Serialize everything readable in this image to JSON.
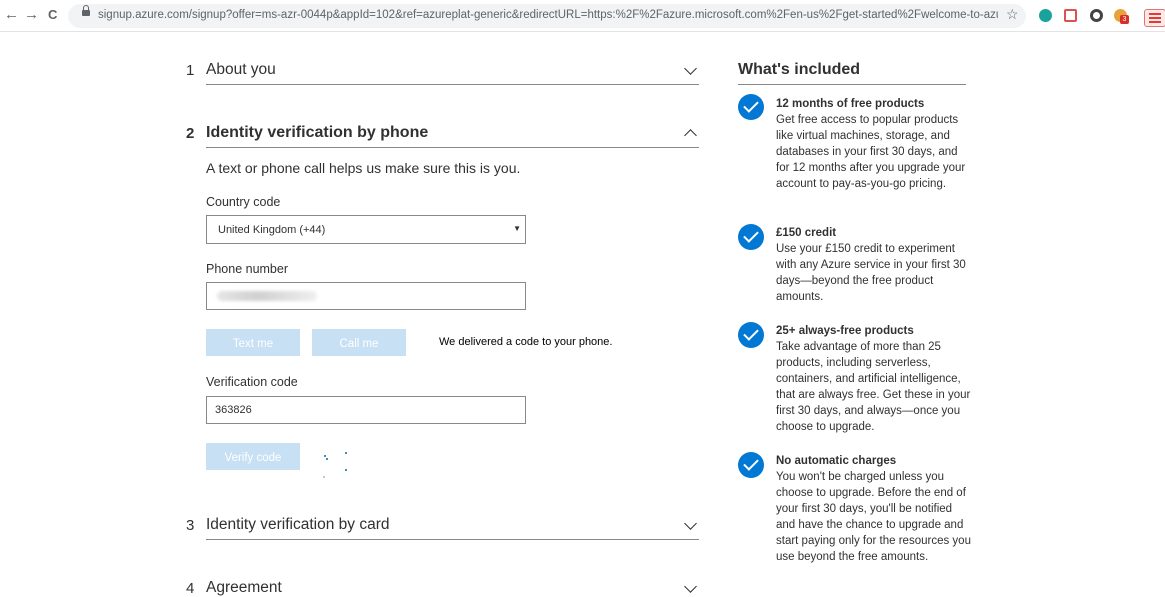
{
  "browser": {
    "back": "←",
    "forward": "→",
    "reload": "C",
    "url": "signup.azure.com/signup?offer=ms-azr-0044p&appId=102&ref=azureplat-generic&redirectURL=https:%2F%2Fazure.microsoft.com%2Fen-us%2Fget-started%2Fwelcome-to-azure%2...",
    "bookmark": "☆",
    "ext_badge": "3"
  },
  "steps": [
    {
      "num": "1",
      "title": "About you"
    },
    {
      "num": "2",
      "title": "Identity verification by phone"
    },
    {
      "num": "3",
      "title": "Identity verification by card"
    },
    {
      "num": "4",
      "title": "Agreement"
    }
  ],
  "phone_section": {
    "intro": "A text or phone call helps us make sure this is you.",
    "country_label": "Country code",
    "country_value": "United Kingdom (+44)",
    "phone_label": "Phone number",
    "text_me": "Text me",
    "call_me": "Call me",
    "delivered_msg": "We delivered a code to your phone.",
    "verification_label": "Verification code",
    "verification_value": "363826",
    "verify_button": "Verify code"
  },
  "included": {
    "title": "What's included",
    "items": [
      {
        "heading": "12 months of free products",
        "body": "Get free access to popular products like virtual machines, storage, and databases in your first 30 days, and for 12 months after you upgrade your account to pay-as-you-go pricing."
      },
      {
        "heading": "£150 credit",
        "body": "Use your £150 credit to experiment with any Azure service in your first 30 days—beyond the free product amounts."
      },
      {
        "heading": "25+ always-free products",
        "body": "Take advantage of more than 25 products, including serverless, containers, and artificial intelligence, that are always free. Get these in your first 30 days, and always—once you choose to upgrade."
      },
      {
        "heading": "No automatic charges",
        "body": "You won't be charged unless you choose to upgrade. Before the end of your first 30 days, you'll be notified and have the chance to upgrade and start paying only for the resources you use beyond the free amounts."
      }
    ]
  },
  "colors": {
    "accent": "#0078d4",
    "disabled_button": "#c7e0f4"
  }
}
